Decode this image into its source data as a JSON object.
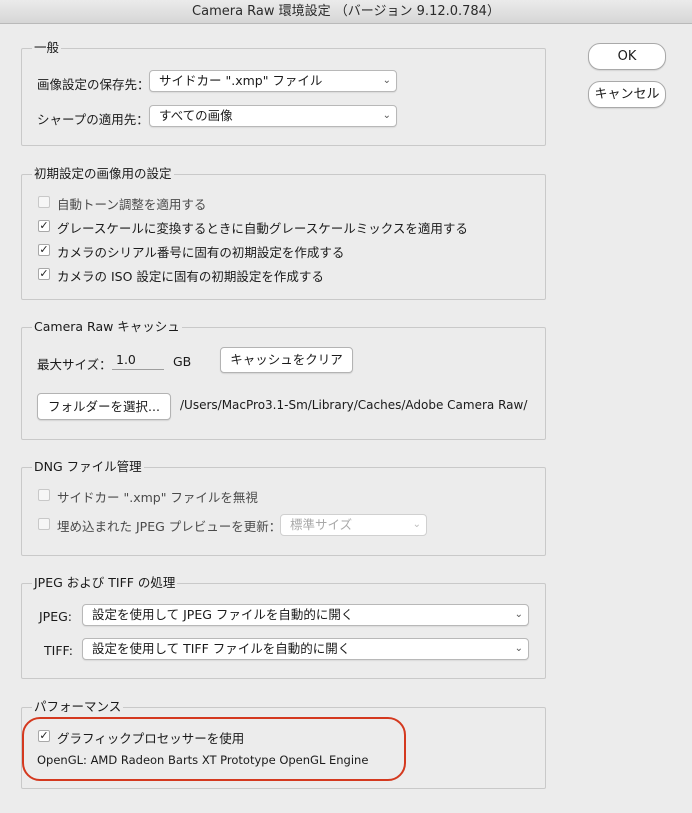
{
  "window": {
    "title": "Camera Raw 環境設定 （バージョン 9.12.0.784）"
  },
  "buttons": {
    "ok": "OK",
    "cancel": "キャンセル"
  },
  "general": {
    "legend": "一般",
    "save_label": "画像設定の保存先：",
    "save_value": "サイドカー \".xmp\" ファイル",
    "sharpen_label": "シャープの適用先：",
    "sharpen_value": "すべての画像"
  },
  "defaults": {
    "legend": "初期設定の画像用の設定",
    "items": [
      {
        "label": "自動トーン調整を適用する",
        "checked": false
      },
      {
        "label": "グレースケールに変換するときに自動グレースケールミックスを適用する",
        "checked": true
      },
      {
        "label": "カメラのシリアル番号に固有の初期設定を作成する",
        "checked": true
      },
      {
        "label": "カメラの ISO 設定に固有の初期設定を作成する",
        "checked": true
      }
    ]
  },
  "cache": {
    "legend": "Camera Raw キャッシュ",
    "max_size_label": "最大サイズ：",
    "max_size_value": "1.0",
    "unit": "GB",
    "purge_button": "キャッシュをクリア",
    "folder_button": "フォルダーを選択...",
    "path": "/Users/MacPro3.1-Sm/Library/Caches/Adobe Camera Raw/"
  },
  "dng": {
    "legend": "DNG ファイル管理",
    "ignore_sidecar": "サイドカー \".xmp\" ファイルを無視",
    "update_preview": "埋め込まれた JPEG プレビューを更新：",
    "preview_size": "標準サイズ"
  },
  "jpeg_tiff": {
    "legend": "JPEG および TIFF の処理",
    "jpeg_label": "JPEG:",
    "jpeg_value": "設定を使用して JPEG ファイルを自動的に開く",
    "tiff_label": "TIFF:",
    "tiff_value": "設定を使用して TIFF ファイルを自動的に開く"
  },
  "performance": {
    "legend": "パフォーマンス",
    "gpu_label": "グラフィックプロセッサーを使用",
    "gpu_checked": true,
    "opengl_info": "OpenGL: AMD Radeon Barts XT Prototype OpenGL Engine"
  },
  "colors": {
    "highlight": "#d4391f",
    "background": "#ececec"
  }
}
